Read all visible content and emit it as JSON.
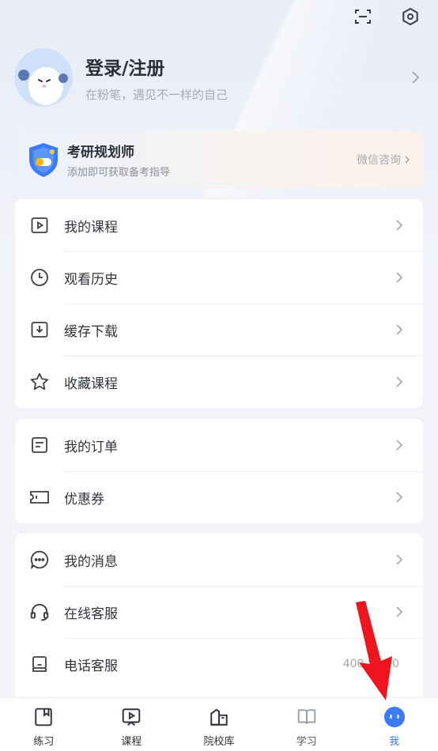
{
  "header": {
    "icons": [
      "scan-icon",
      "settings-icon"
    ]
  },
  "profile": {
    "title": "登录/注册",
    "subtitle": "在粉笔，遇见不一样的自己"
  },
  "planner": {
    "title": "考研规划师",
    "subtitle": "添加即可获取备考指导",
    "link": "微信咨询"
  },
  "menu_group_1": [
    {
      "label": "我的课程",
      "icon": "play-box-icon"
    },
    {
      "label": "观看历史",
      "icon": "clock-icon"
    },
    {
      "label": "缓存下载",
      "icon": "download-icon"
    },
    {
      "label": "收藏课程",
      "icon": "star-icon"
    }
  ],
  "menu_group_2": [
    {
      "label": "我的订单",
      "icon": "order-icon"
    },
    {
      "label": "优惠券",
      "icon": "coupon-icon"
    }
  ],
  "menu_group_3": [
    {
      "label": "我的消息",
      "icon": "chat-icon"
    },
    {
      "label": "在线客服",
      "icon": "headset-icon"
    },
    {
      "label": "电话客服",
      "icon": "phone-icon",
      "value": "400 85  00"
    }
  ],
  "tabs": [
    {
      "label": "练习",
      "icon": "bookmark-book-icon"
    },
    {
      "label": "课程",
      "icon": "video-icon"
    },
    {
      "label": "院校库",
      "icon": "school-icon"
    },
    {
      "label": "学习",
      "icon": "open-book-icon"
    },
    {
      "label": "我",
      "icon": "me-icon",
      "active": true
    }
  ],
  "colors": {
    "accent": "#3b7cf6",
    "arrow": "#f0141e"
  }
}
